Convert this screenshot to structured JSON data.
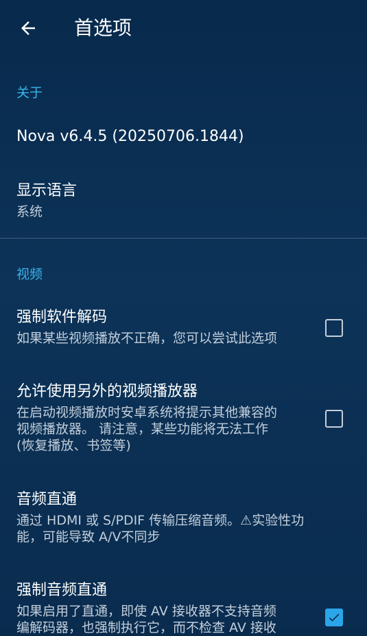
{
  "header": {
    "title": "首选项",
    "back_icon": "arrow-left-icon"
  },
  "sections": [
    {
      "header": "关于",
      "items": [
        {
          "title": "Nova v6.4.5 (20250706.1844)"
        },
        {
          "title": "显示语言",
          "summary": "系统"
        }
      ]
    },
    {
      "header": "视频",
      "items": [
        {
          "title": "强制软件解码",
          "summary": "如果某些视频播放不正确，您可以尝试此选项",
          "checked": false
        },
        {
          "title": "允许使用另外的视频播放器",
          "summary_lines": [
            "在启动视频播放时安卓系统将提示其他兼容的",
            "视频播放器。 请注意，某些功能将无法工作",
            "(恢复播放、书签等)"
          ],
          "checked": false
        },
        {
          "title": "音频直通",
          "summary_lines": [
            "通过 HDMI 或 S/PDIF 传输压缩音频。⚠实验性功",
            "能，可能导致 A/V不同步"
          ]
        },
        {
          "title": "强制音频直通",
          "summary_lines": [
            "如果启用了直通，即使 AV 接收器不支持音频",
            "编解码器，也强制执行它，而不检查 AV 接收"
          ],
          "checked": true
        }
      ]
    }
  ],
  "colors": {
    "accent": "#3ab4ef",
    "checkbox_checked": "#2aa6e8",
    "background": "#0c3358"
  }
}
